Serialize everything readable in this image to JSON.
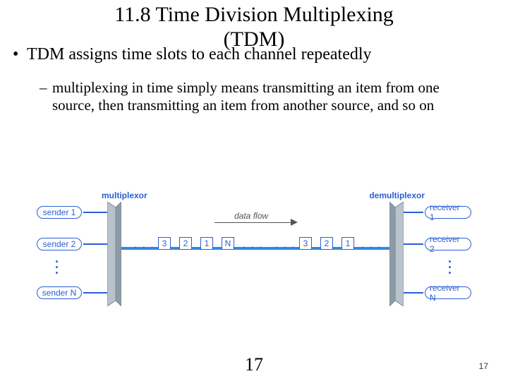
{
  "title_line1": "11.8  Time Division Multiplexing",
  "title_line2": "(TDM)",
  "bullet1": "TDM assigns time slots to each channel repeatedly",
  "bullet2": "multiplexing in time simply means transmitting an item from one source, then transmitting an item from another source, and so on",
  "diagram": {
    "mux_label": "multiplexor",
    "demux_label": "demultiplexor",
    "dataflow": "data flow",
    "senders": [
      "sender 1",
      "sender 2",
      "sender N"
    ],
    "receivers": [
      "receiver 1",
      "receiver 2",
      "receiver N"
    ],
    "slots_left": [
      "3",
      "2",
      "1",
      "N"
    ],
    "slots_right": [
      "3",
      "2",
      "1"
    ]
  },
  "page_big": "17",
  "page_small": "17"
}
